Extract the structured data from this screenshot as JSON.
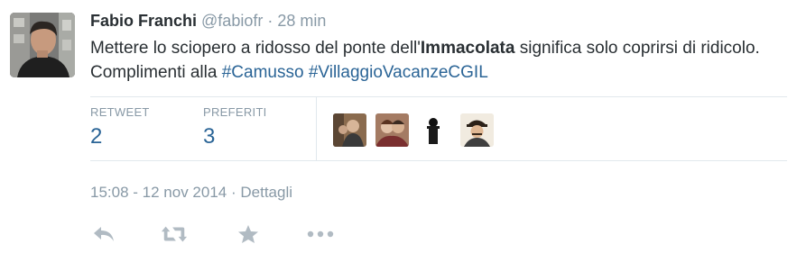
{
  "author": {
    "name": "Fabio Franchi",
    "handle": "@fabiofr",
    "separator": "·",
    "time_ago": "28 min"
  },
  "tweet": {
    "text_before_bold": "Mettere lo sciopero a ridosso del ponte dell'",
    "bold_word": "Immacolata",
    "text_after_bold": " significa solo coprirsi di ridicolo. Complimenti alla ",
    "hashtag_1": "#Camusso",
    "space": " ",
    "hashtag_2": "#VillaggioVacanzeCGIL"
  },
  "stats": {
    "retweet_label": "RETWEET",
    "retweet_count": "2",
    "favorites_label": "PREFERITI",
    "favorites_count": "3"
  },
  "footer": {
    "timestamp": "15:08 - 12 nov 2014",
    "separator": "·",
    "details_link": "Dettagli"
  },
  "actions": {
    "icons": [
      "reply-icon",
      "retweet-icon",
      "favorite-icon",
      "more-icon"
    ]
  },
  "colors": {
    "text": "#292f33",
    "muted": "#8899a6",
    "link": "#2a6496",
    "divider": "#e1e8ed",
    "icon": "#b1bbc3"
  }
}
